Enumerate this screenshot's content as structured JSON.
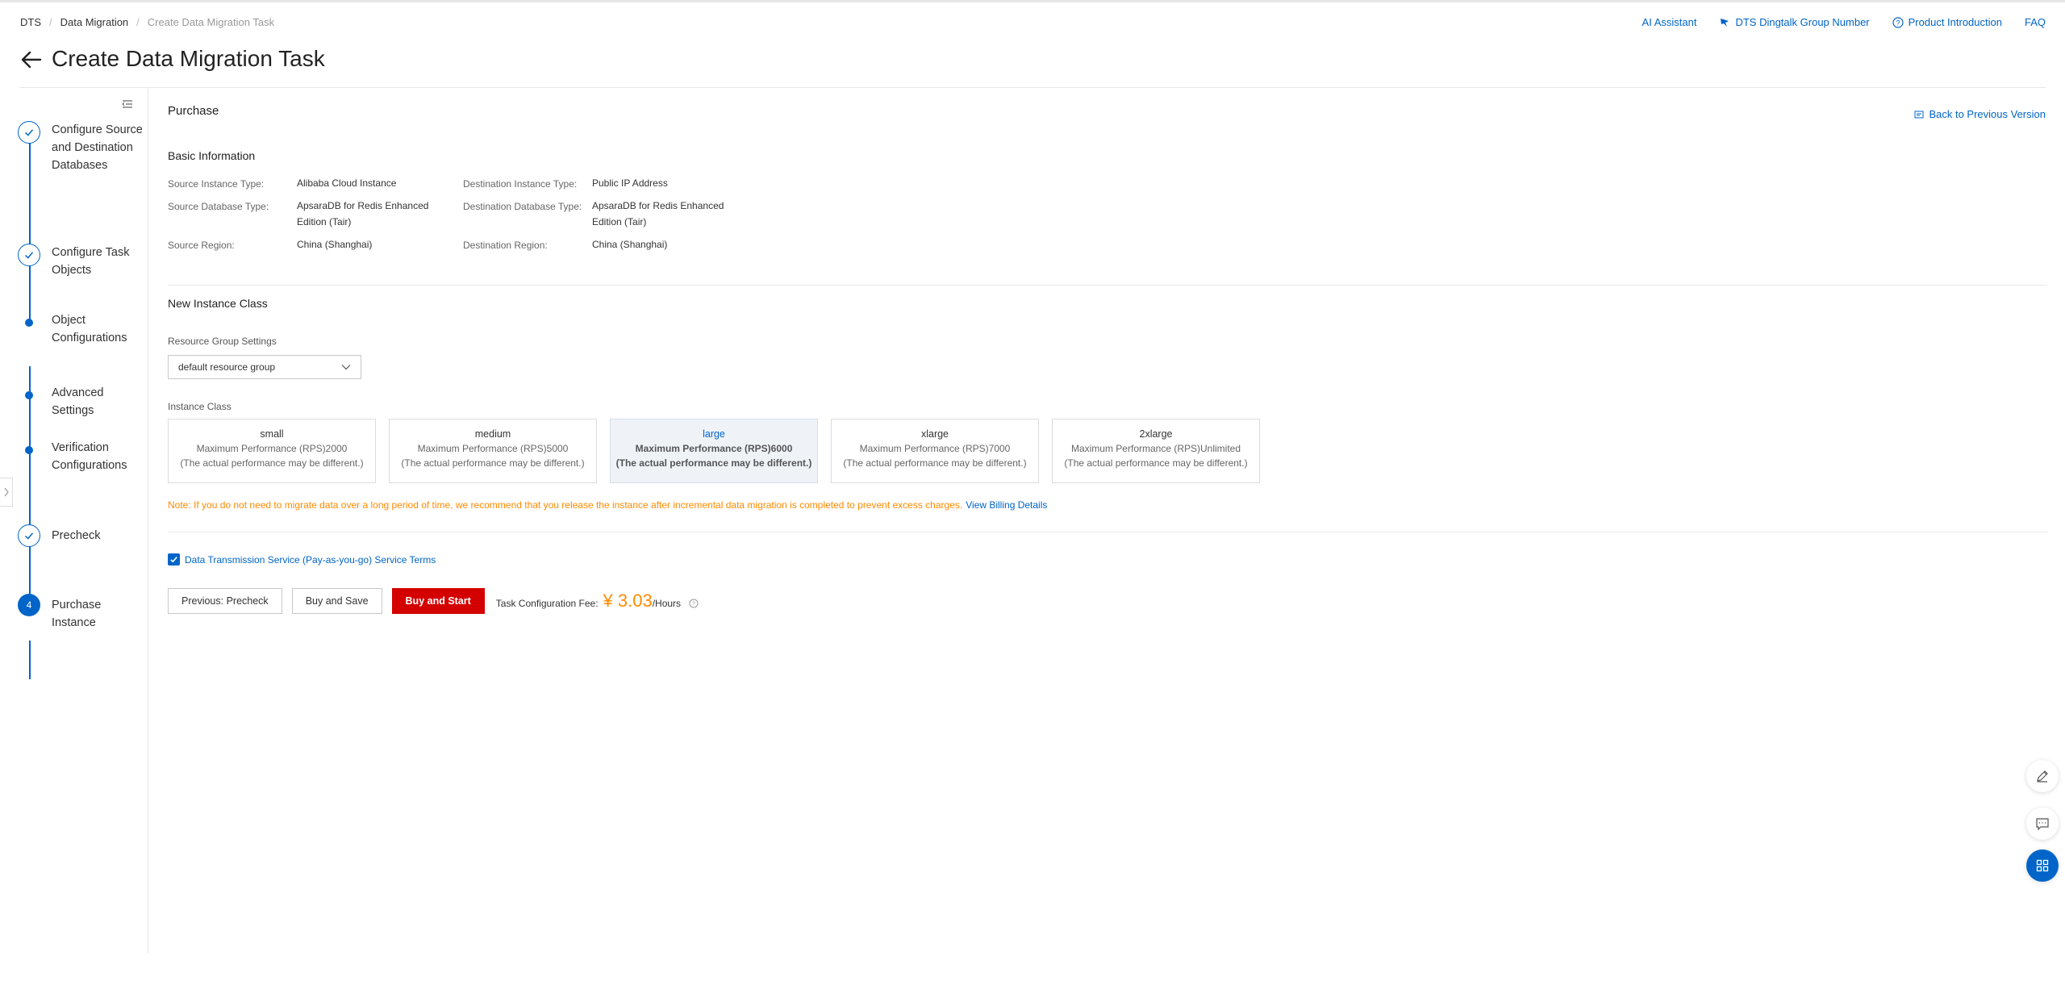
{
  "breadcrumb": [
    "DTS",
    "Data Migration",
    "Create Data Migration Task"
  ],
  "top_links": {
    "ai": "AI Assistant",
    "dingtalk": "DTS Dingtalk Group Number",
    "product": "Product Introduction",
    "faq": "FAQ"
  },
  "page_title": "Create Data Migration Task",
  "steps": [
    {
      "label": "Configure Source and Destination Databases",
      "state": "done"
    },
    {
      "label": "Configure Task Objects",
      "state": "done"
    },
    {
      "label": "Object Configurations",
      "state": "dot"
    },
    {
      "label": "Advanced Settings",
      "state": "dot"
    },
    {
      "label": "Verification Configurations",
      "state": "dot"
    },
    {
      "label": "Precheck",
      "state": "done"
    },
    {
      "label": "Purchase Instance",
      "state": "current",
      "number": "4"
    }
  ],
  "purchase": {
    "title": "Purchase",
    "back_prev": "Back to Previous Version"
  },
  "basic_info": {
    "title": "Basic Information",
    "source_instance_type_label": "Source Instance Type:",
    "source_instance_type": "Alibaba Cloud Instance",
    "dest_instance_type_label": "Destination Instance Type:",
    "dest_instance_type": "Public IP Address",
    "source_db_type_label": "Source Database Type:",
    "source_db_type_1": "ApsaraDB for Redis Enhanced",
    "source_db_type_2": "Edition (Tair)",
    "dest_db_type_label": "Destination Database Type:",
    "dest_db_type_1": "ApsaraDB for Redis Enhanced",
    "dest_db_type_2": "Edition (Tair)",
    "source_region_label": "Source Region:",
    "source_region": "China (Shanghai)",
    "dest_region_label": "Destination Region:",
    "dest_region": "China (Shanghai)"
  },
  "instance_class": {
    "title": "New Instance Class",
    "resource_group_label": "Resource Group Settings",
    "resource_group_value": "default resource group",
    "class_label": "Instance Class",
    "selected": "large",
    "options": [
      {
        "name": "small",
        "perf": "Maximum Performance (RPS)2000",
        "note": "(The actual performance may be different.)"
      },
      {
        "name": "medium",
        "perf": "Maximum Performance (RPS)5000",
        "note": "(The actual performance may be different.)"
      },
      {
        "name": "large",
        "perf": "Maximum Performance (RPS)6000",
        "note": "(The actual performance may be different.)"
      },
      {
        "name": "xlarge",
        "perf": "Maximum Performance (RPS)7000",
        "note": "(The actual performance may be different.)"
      },
      {
        "name": "2xlarge",
        "perf": "Maximum Performance (RPS)Unlimited",
        "note": "(The actual performance may be different.)"
      }
    ],
    "note": "Note: If you do not need to migrate data over a long period of time, we recommend that you release the instance after incremental data migration is completed to prevent excess charges.",
    "billing_link": "View Billing Details"
  },
  "terms": {
    "checked": true,
    "label": "Data Transmission Service (Pay-as-you-go) Service Terms"
  },
  "actions": {
    "previous": "Previous: Precheck",
    "buy_save": "Buy and Save",
    "buy_start": "Buy and Start",
    "fee_label": "Task Configuration Fee:",
    "fee_amount": "¥ 3.03",
    "fee_unit": "/Hours"
  },
  "colors": {
    "accent": "#0064c8",
    "primary_button": "#d40000",
    "warning": "#ff8a00"
  }
}
